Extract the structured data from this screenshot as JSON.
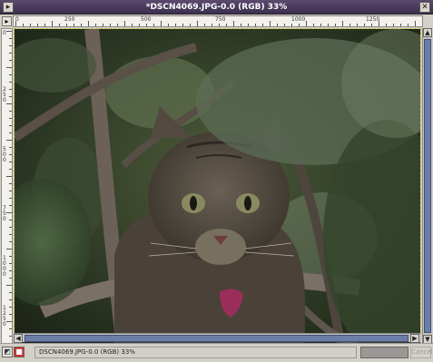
{
  "window": {
    "title": "*DSCN4069.JPG-0.0 (RGB) 33%",
    "menu_glyph": "▸",
    "close_glyph": "✕"
  },
  "rulers": {
    "horizontal_labels": [
      "0",
      "250",
      "500",
      "750",
      "1000",
      "1250"
    ],
    "vertical_labels": [
      "0",
      "250",
      "500",
      "750",
      "1000",
      "1250"
    ]
  },
  "canvas": {
    "corner_glyph": "▸",
    "image_description_icon": "cat-photo-image",
    "up_arrow": "▲",
    "down_arrow": "▼",
    "left_arrow": "◀",
    "right_arrow": "▶",
    "navigate_glyph": "✥"
  },
  "statusbar": {
    "text": "DSCN4069.JPG-0.0 (RGB) 33%",
    "cancel_label": "Cancel",
    "qmask_glyph": "◩",
    "stop_glyph": "■"
  },
  "colors": {
    "title_bg": "#4a3c5e",
    "scroll_thumb": "#6c7ea8",
    "selection_border": "#c8c040"
  }
}
